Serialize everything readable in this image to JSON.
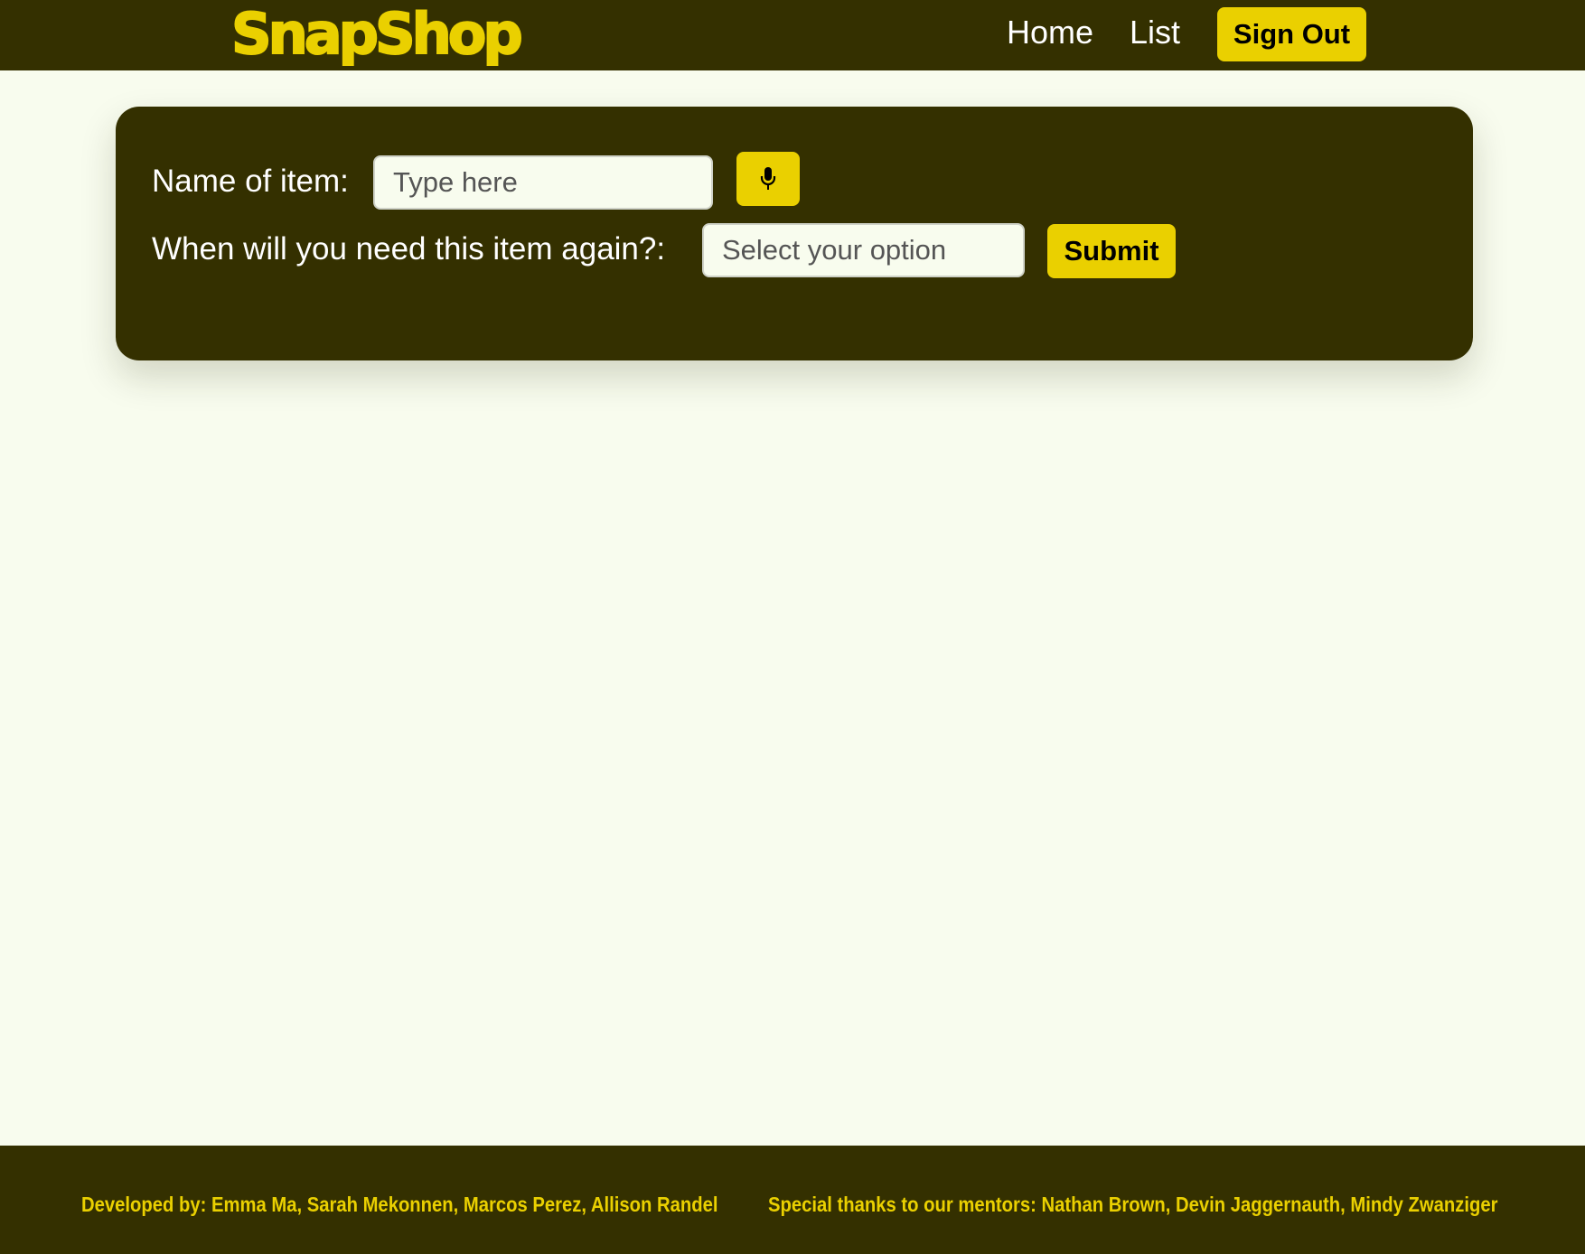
{
  "navbar": {
    "logo": "SnapShop",
    "links": {
      "home": "Home",
      "list": "List"
    },
    "sign_out_label": "Sign Out"
  },
  "form": {
    "item_name_label": "Name of item:",
    "item_name_placeholder": "Type here",
    "item_name_value": "",
    "when_label": "When will you need this item again?:",
    "when_select_value": "Select your option",
    "mic_button_icon": "microphone-icon",
    "submit_label": "Submit"
  },
  "footer": {
    "developed_by": "Developed by: Emma Ma, Sarah Mekonnen, Marcos Perez, Allison Randel",
    "special_thanks": "Special thanks to our mentors: Nathan Brown, Devin Jaggernauth, Mindy Zwanziger"
  },
  "colors": {
    "dark_olive": "#343000",
    "accent_yellow": "#ead000",
    "page_background": "#f8fcee",
    "white_text": "#ffffff"
  }
}
